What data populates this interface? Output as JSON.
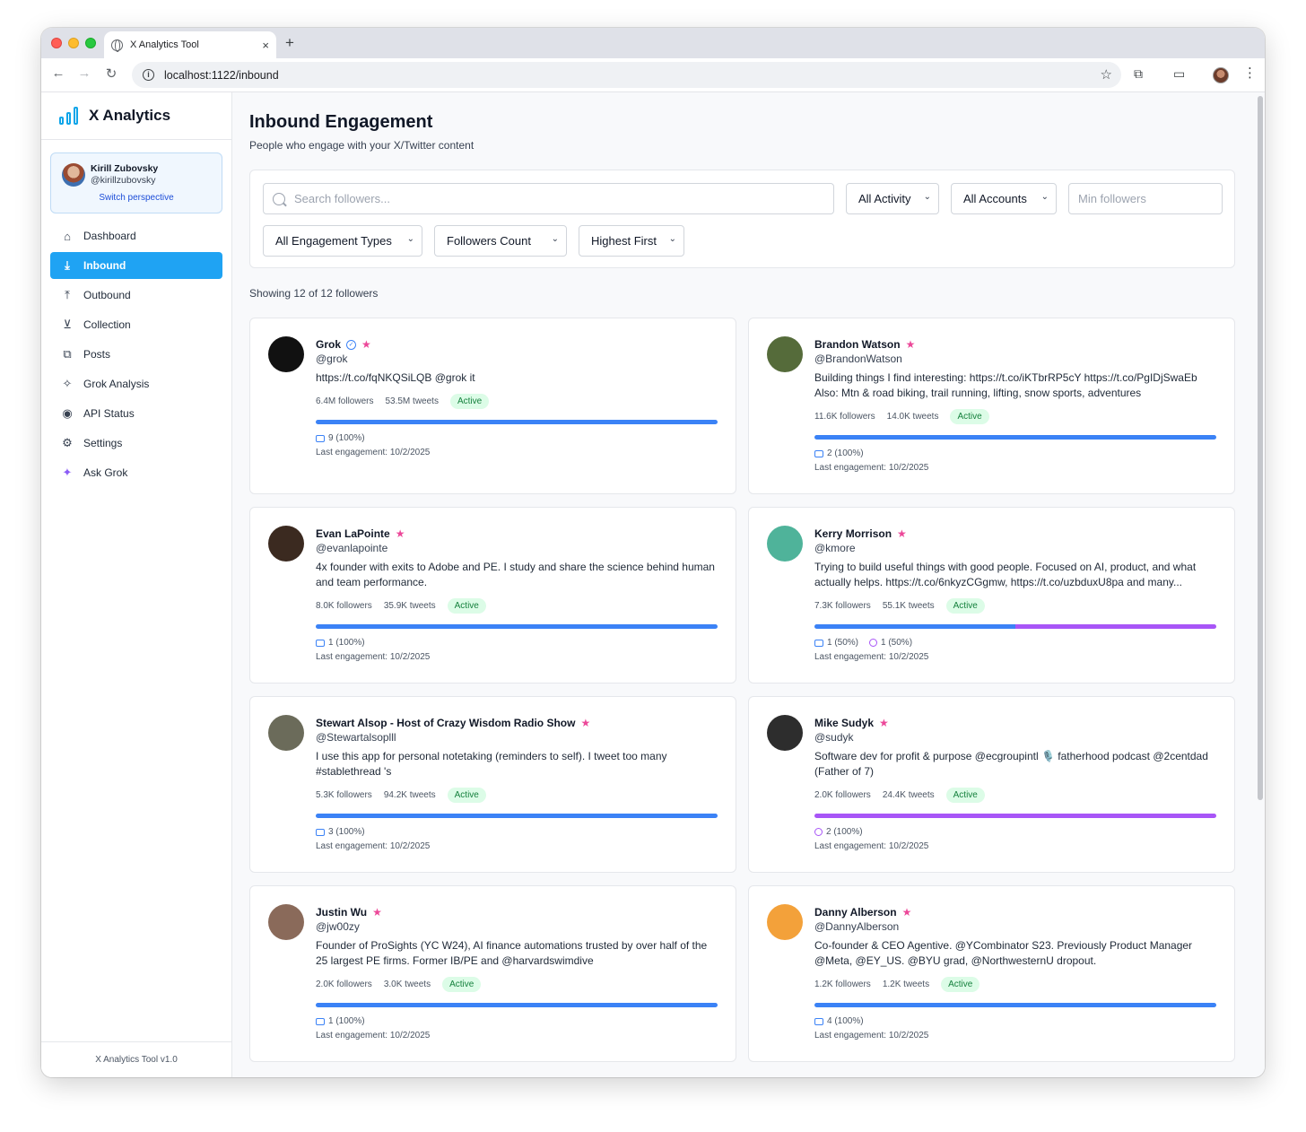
{
  "browser": {
    "tab_title": "X Analytics Tool",
    "url": "localhost:1122/inbound",
    "tab_close": "×",
    "new_tab": "+"
  },
  "sidebar": {
    "brand": "X Analytics",
    "user": {
      "name": "Kirill Zubovsky",
      "handle": "@kirillzubovsky",
      "switch_label": "Switch perspective"
    },
    "items": [
      {
        "label": "Dashboard",
        "icon": "home-icon",
        "glyph": "⌂"
      },
      {
        "label": "Inbound",
        "icon": "download-icon",
        "glyph": "⤓"
      },
      {
        "label": "Outbound",
        "icon": "upload-icon",
        "glyph": "⤒"
      },
      {
        "label": "Collection",
        "icon": "download-circle-icon",
        "glyph": "⊻"
      },
      {
        "label": "Posts",
        "icon": "messages-icon",
        "glyph": "⧉"
      },
      {
        "label": "Grok Analysis",
        "icon": "sparkles-icon",
        "glyph": "✧"
      },
      {
        "label": "API Status",
        "icon": "radio-icon",
        "glyph": "◉"
      },
      {
        "label": "Settings",
        "icon": "gear-icon",
        "glyph": "⚙"
      },
      {
        "label": "Ask Grok",
        "icon": "sparkles-purple-icon",
        "glyph": "✦"
      }
    ],
    "footer": "X Analytics Tool v1.0"
  },
  "header": {
    "title": "Inbound Engagement",
    "subtitle": "People who engage with your X/Twitter content"
  },
  "filters": {
    "search_placeholder": "Search followers...",
    "activity": "All Activity",
    "accounts": "All Accounts",
    "min_placeholder": "Min followers",
    "engagement_types": "All Engagement Types",
    "sort_by": "Followers Count",
    "order": "Highest First"
  },
  "showing": "Showing 12 of 12 followers",
  "colors": {
    "accent": "#1fa3f3",
    "reply": "#3b82f6",
    "quote": "#a855f7",
    "star": "#ec4899",
    "active_badge": "#dcfce7"
  },
  "cards": [
    {
      "name": "Grok",
      "handle": "@grok",
      "verified": true,
      "bio": "https://t.co/fqNKQSiLQB @grok it",
      "followers": "6.4M followers",
      "tweets": "53.5M tweets",
      "status": "Active",
      "replies": "9 (100%)",
      "quotes": "",
      "reply_share": 100,
      "quote_share": 0,
      "last": "Last engagement: 10/2/2025",
      "avatar": "#111111"
    },
    {
      "name": "Brandon Watson",
      "handle": "@BrandonWatson",
      "verified": false,
      "bio": "Building things I find interesting: https://t.co/iKTbrRP5cY https://t.co/PgIDjSwaEb Also: Mtn & road biking, trail running, lifting, snow sports, adventures",
      "followers": "11.6K followers",
      "tweets": "14.0K tweets",
      "status": "Active",
      "replies": "2 (100%)",
      "quotes": "",
      "reply_share": 100,
      "quote_share": 0,
      "last": "Last engagement: 10/2/2025",
      "avatar": "#556b3a"
    },
    {
      "name": "Evan LaPointe",
      "handle": "@evanlapointe",
      "verified": false,
      "bio": "4x founder with exits to Adobe and PE. I study and share the science behind human and team performance.",
      "followers": "8.0K followers",
      "tweets": "35.9K tweets",
      "status": "Active",
      "replies": "1 (100%)",
      "quotes": "",
      "reply_share": 100,
      "quote_share": 0,
      "last": "Last engagement: 10/2/2025",
      "avatar": "#3b2a20"
    },
    {
      "name": "Kerry Morrison",
      "handle": "@kmore",
      "verified": false,
      "bio": "Trying to build useful things with good people. Focused on AI, product, and what actually helps. https://t.co/6nkyzCGgmw, https://t.co/uzbduxU8pa and many...",
      "followers": "7.3K followers",
      "tweets": "55.1K tweets",
      "status": "Active",
      "replies": "1 (50%)",
      "quotes": "1 (50%)",
      "reply_share": 50,
      "quote_share": 50,
      "last": "Last engagement: 10/2/2025",
      "avatar": "#4fb39a"
    },
    {
      "name": "Stewart Alsop - Host of Crazy Wisdom Radio Show",
      "handle": "@Stewartalsoplll",
      "verified": false,
      "bio": "I use this app for personal notetaking (reminders to self). I tweet too many #stablethread 's",
      "followers": "5.3K followers",
      "tweets": "94.2K tweets",
      "status": "Active",
      "replies": "3 (100%)",
      "quotes": "",
      "reply_share": 100,
      "quote_share": 0,
      "last": "Last engagement: 10/2/2025",
      "avatar": "#6b6b5a"
    },
    {
      "name": "Mike Sudyk",
      "handle": "@sudyk",
      "verified": false,
      "bio": "Software dev for profit & purpose @ecgroupintl 🎙️ fatherhood podcast @2centdad (Father of 7)",
      "followers": "2.0K followers",
      "tweets": "24.4K tweets",
      "status": "Active",
      "replies": "",
      "quotes": "2 (100%)",
      "reply_share": 0,
      "quote_share": 100,
      "last": "Last engagement: 10/2/2025",
      "avatar": "#2d2d2d"
    },
    {
      "name": "Justin Wu",
      "handle": "@jw00zy",
      "verified": false,
      "bio": "Founder of ProSights (YC W24), AI finance automations trusted by over half of the 25 largest PE firms. Former IB/PE and @harvardswimdive",
      "followers": "2.0K followers",
      "tweets": "3.0K tweets",
      "status": "Active",
      "replies": "1 (100%)",
      "quotes": "",
      "reply_share": 100,
      "quote_share": 0,
      "last": "Last engagement: 10/2/2025",
      "avatar": "#8a6a5a"
    },
    {
      "name": "Danny Alberson",
      "handle": "@DannyAlberson",
      "verified": false,
      "bio": "Co-founder & CEO Agentive. @YCombinator S23. Previously Product Manager @Meta, @EY_US. @BYU grad, @NorthwesternU dropout.",
      "followers": "1.2K followers",
      "tweets": "1.2K tweets",
      "status": "Active",
      "replies": "4 (100%)",
      "quotes": "",
      "reply_share": 100,
      "quote_share": 0,
      "last": "Last engagement: 10/2/2025",
      "avatar": "#f3a13a"
    }
  ]
}
